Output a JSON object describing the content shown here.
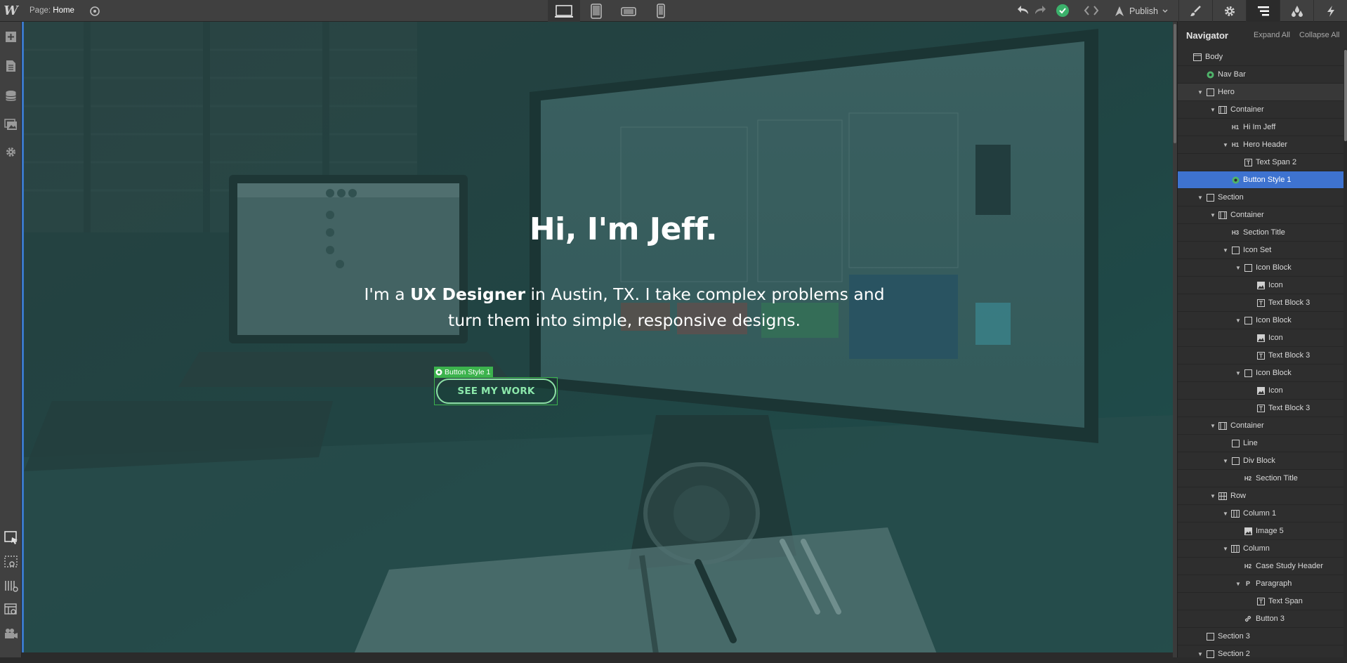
{
  "topbar": {
    "logo": "W",
    "page_label": "Page:",
    "page_name": "Home",
    "publish_label": "Publish",
    "devices": [
      "desktop-icon",
      "tablet-icon",
      "mobile-landscape-icon",
      "mobile-portrait-icon"
    ],
    "right_tabs": [
      "style-brush-icon",
      "settings-gear-icon",
      "navigator-icon",
      "style-manager-drops-icon",
      "interactions-bolt-icon"
    ]
  },
  "left_toolbar": {
    "top": [
      "add-panel-icon",
      "pages-icon",
      "cms-icon",
      "assets-icon",
      "settings-icon"
    ],
    "bottom": [
      "select-element-icon",
      "preview-outline-icon",
      "grid-overlay-icon",
      "xray-icon",
      "video-tutorial-icon"
    ]
  },
  "canvas": {
    "hero_title": "Hi, I'm Jeff.",
    "hero_para_pre": "I'm a ",
    "hero_para_bold": "UX Designer",
    "hero_para_post": " in Austin, TX. I take complex problems and turn them into simple, responsive designs.",
    "button_label": "SEE MY WORK",
    "selection_tag": "Button Style 1"
  },
  "navigator": {
    "title": "Navigator",
    "expand_all": "Expand All",
    "collapse_all": "Collapse All",
    "nodes": [
      {
        "label": "Body",
        "icon": "body",
        "depth": 0,
        "caret": false
      },
      {
        "label": "Nav Bar",
        "icon": "symbol",
        "depth": 1,
        "caret": false
      },
      {
        "label": "Hero",
        "icon": "box",
        "depth": 1,
        "caret": true,
        "state": "hl"
      },
      {
        "label": "Container",
        "icon": "container",
        "depth": 2,
        "caret": true
      },
      {
        "label": "Hi Im Jeff",
        "icon": "h1",
        "depth": 3,
        "caret": false
      },
      {
        "label": "Hero Header",
        "icon": "h1",
        "depth": 3,
        "caret": true
      },
      {
        "label": "Text Span 2",
        "icon": "text",
        "depth": 4,
        "caret": false
      },
      {
        "label": "Button Style 1",
        "icon": "symbol",
        "depth": 3,
        "caret": false,
        "state": "sel"
      },
      {
        "label": "Section",
        "icon": "box",
        "depth": 1,
        "caret": true
      },
      {
        "label": "Container",
        "icon": "container",
        "depth": 2,
        "caret": true
      },
      {
        "label": "Section Title",
        "icon": "h3",
        "depth": 3,
        "caret": false
      },
      {
        "label": "Icon Set",
        "icon": "box",
        "depth": 3,
        "caret": true
      },
      {
        "label": "Icon Block",
        "icon": "box",
        "depth": 4,
        "caret": true
      },
      {
        "label": "Icon",
        "icon": "image",
        "depth": 5,
        "caret": false
      },
      {
        "label": "Text Block 3",
        "icon": "text",
        "depth": 5,
        "caret": false
      },
      {
        "label": "Icon Block",
        "icon": "box",
        "depth": 4,
        "caret": true
      },
      {
        "label": "Icon",
        "icon": "image",
        "depth": 5,
        "caret": false
      },
      {
        "label": "Text Block 3",
        "icon": "text",
        "depth": 5,
        "caret": false
      },
      {
        "label": "Icon Block",
        "icon": "box",
        "depth": 4,
        "caret": true
      },
      {
        "label": "Icon",
        "icon": "image",
        "depth": 5,
        "caret": false
      },
      {
        "label": "Text Block 3",
        "icon": "text",
        "depth": 5,
        "caret": false
      },
      {
        "label": "Container",
        "icon": "container",
        "depth": 2,
        "caret": true
      },
      {
        "label": "Line",
        "icon": "box",
        "depth": 3,
        "caret": false
      },
      {
        "label": "Div Block",
        "icon": "box",
        "depth": 3,
        "caret": true
      },
      {
        "label": "Section Title",
        "icon": "h2",
        "depth": 4,
        "caret": false
      },
      {
        "label": "Row",
        "icon": "row",
        "depth": 2,
        "caret": true
      },
      {
        "label": "Column 1",
        "icon": "column",
        "depth": 3,
        "caret": true
      },
      {
        "label": "Image 5",
        "icon": "image",
        "depth": 4,
        "caret": false
      },
      {
        "label": "Column",
        "icon": "column",
        "depth": 3,
        "caret": true
      },
      {
        "label": "Case Study Header",
        "icon": "h2",
        "depth": 4,
        "caret": false
      },
      {
        "label": "Paragraph",
        "icon": "p",
        "depth": 4,
        "caret": true
      },
      {
        "label": "Text Span",
        "icon": "text",
        "depth": 5,
        "caret": false
      },
      {
        "label": "Button 3",
        "icon": "link",
        "depth": 4,
        "caret": false
      },
      {
        "label": "Section 3",
        "icon": "box",
        "depth": 1,
        "caret": false
      },
      {
        "label": "Section 2",
        "icon": "box",
        "depth": 1,
        "caret": true
      }
    ]
  },
  "colors": {
    "selection_green": "#3cb34d",
    "selected_row_blue": "#3e73d0",
    "button_text_green": "#8ce8ab",
    "status_green": "#3bb16b"
  }
}
